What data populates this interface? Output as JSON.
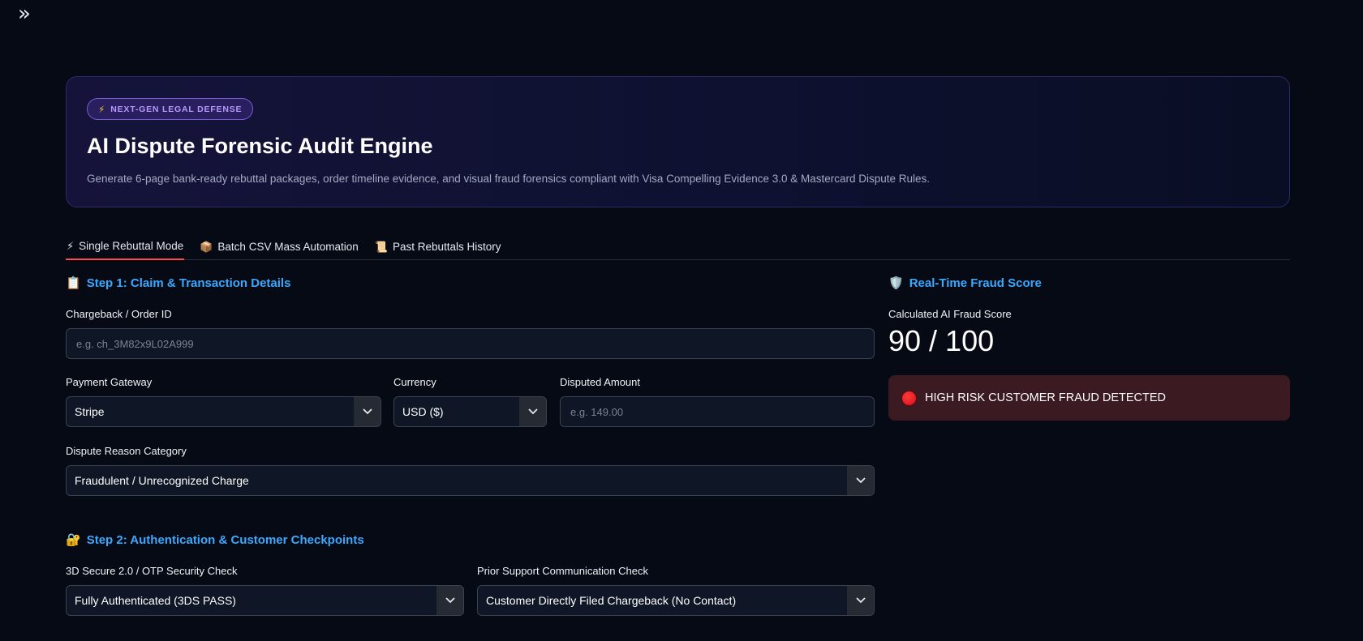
{
  "sidebar": {
    "toggle_glyph": "»"
  },
  "hero": {
    "badge_icon": "⚡",
    "badge": "NEXT-GEN LEGAL DEFENSE",
    "title": "AI Dispute Forensic Audit Engine",
    "subtitle": "Generate 6-page bank-ready rebuttal packages, order timeline evidence, and visual fraud forensics compliant with Visa Compelling Evidence 3.0 & Mastercard Dispute Rules."
  },
  "tabs": [
    {
      "icon": "⚡",
      "label": "Single Rebuttal Mode",
      "active": true
    },
    {
      "icon": "📦",
      "label": "Batch CSV Mass Automation",
      "active": false
    },
    {
      "icon": "📜",
      "label": "Past Rebuttals History",
      "active": false
    }
  ],
  "step1": {
    "icon": "📋",
    "title": "Step 1: Claim & Transaction Details",
    "order_id": {
      "label": "Chargeback / Order ID",
      "value": "",
      "placeholder": "e.g. ch_3M82x9L02A999"
    },
    "gateway": {
      "label": "Payment Gateway",
      "value": "Stripe"
    },
    "currency": {
      "label": "Currency",
      "value": "USD ($)"
    },
    "amount": {
      "label": "Disputed Amount",
      "value": "",
      "placeholder": "e.g. 149.00"
    },
    "reason": {
      "label": "Dispute Reason Category",
      "value": "Fraudulent / Unrecognized Charge"
    }
  },
  "step2": {
    "icon": "🔐",
    "title": "Step 2: Authentication & Customer Checkpoints",
    "secure": {
      "label": "3D Secure 2.0 / OTP Security Check",
      "value": "Fully Authenticated (3DS PASS)"
    },
    "support": {
      "label": "Prior Support Communication Check",
      "value": "Customer Directly Filed Chargeback (No Contact)"
    }
  },
  "fraud": {
    "icon": "🛡️",
    "title": "Real-Time Fraud Score",
    "score_label": "Calculated AI Fraud Score",
    "score": "90 / 100",
    "alert": "HIGH RISK CUSTOMER FRAUD DETECTED"
  },
  "colors": {
    "accent_blue": "#3aa9ff",
    "tab_active": "#ff4b4b",
    "alert_bg": "#3b1a22",
    "badge_purple": "#b798ff"
  }
}
